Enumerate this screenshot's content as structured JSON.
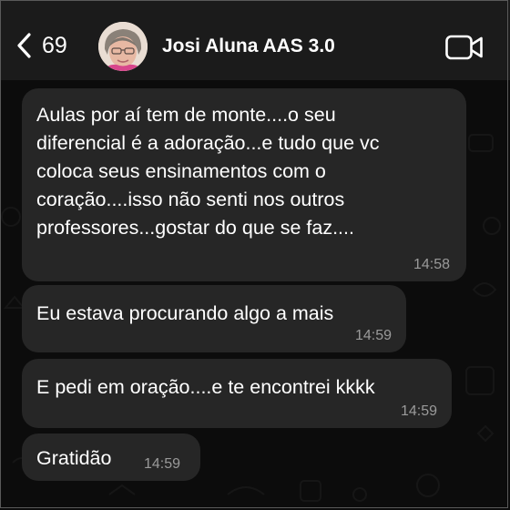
{
  "header": {
    "back_count": "69",
    "contact_name": "Josi Aluna AAS 3.0"
  },
  "messages": [
    {
      "text": "Aulas por aí tem de monte....o seu\ndiferencial é a adoração...e tudo que vc\ncoloca seus ensinamentos com o\ncoração....isso não senti nos outros\nprofessores...gostar do que se faz....",
      "time": "14:58"
    },
    {
      "text": "Eu estava procurando algo  a mais",
      "time": "14:59"
    },
    {
      "text": "E pedi em oração....e te encontrei kkkk",
      "time": "14:59"
    },
    {
      "text": "Gratidão",
      "time": "14:59"
    }
  ],
  "colors": {
    "header_bg": "#1b1b1b",
    "chat_bg": "#0c0c0c",
    "bubble_bg": "#262626",
    "timestamp": "#9a9a9a"
  }
}
